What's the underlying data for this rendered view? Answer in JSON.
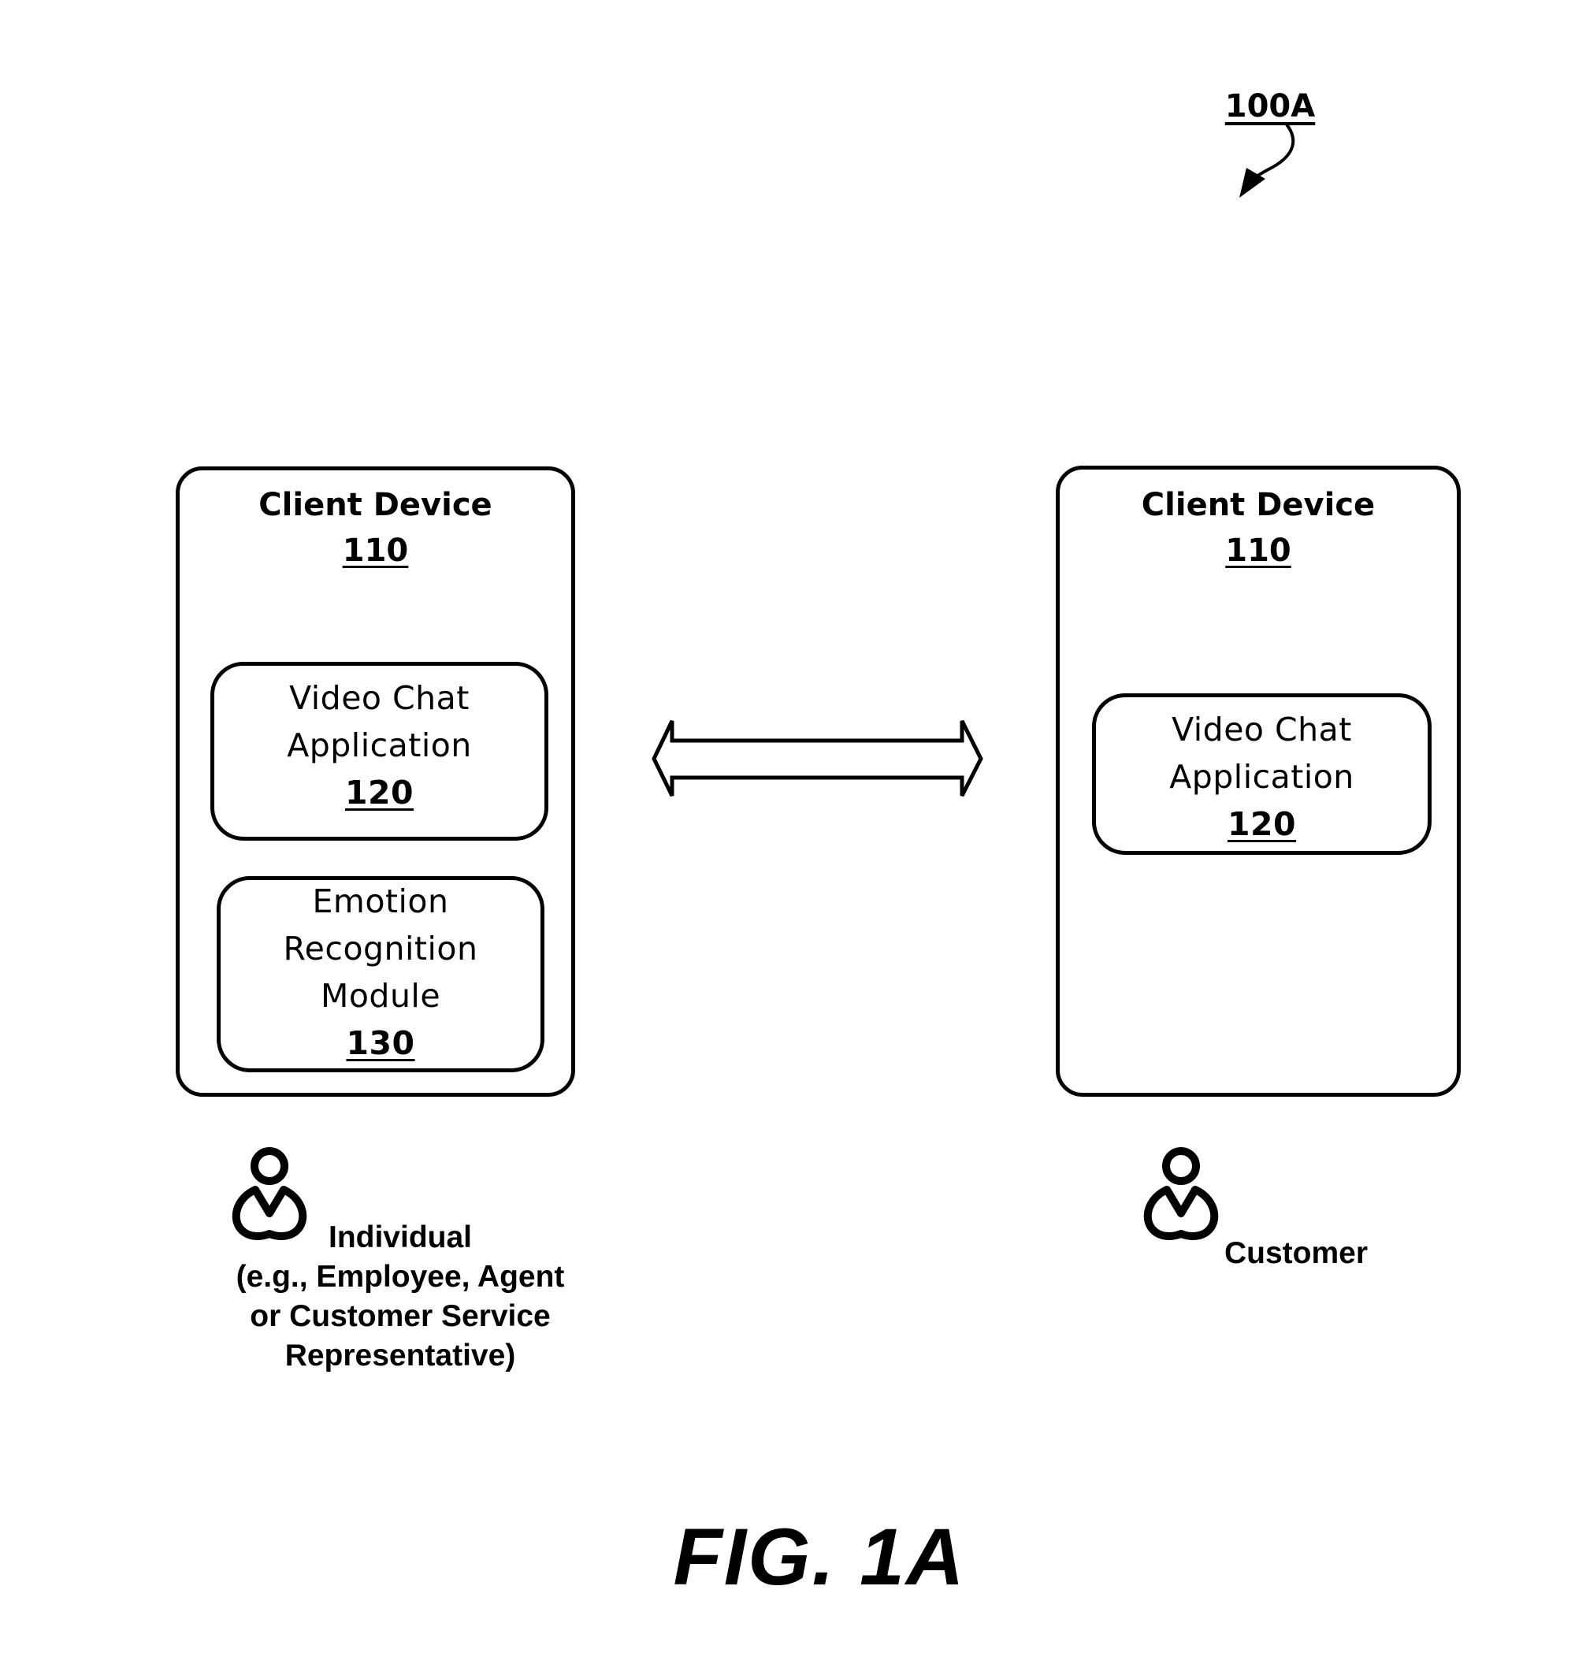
{
  "figure": {
    "ref_label": "100A",
    "caption": "FIG. 1A"
  },
  "left_device": {
    "title": "Client Device",
    "ref": "110",
    "components": [
      {
        "lines": [
          "Video Chat",
          "Application"
        ],
        "ref": "120"
      },
      {
        "lines": [
          "Emotion",
          "Recognition",
          "Module"
        ],
        "ref": "130"
      }
    ],
    "user": {
      "icon": "person-icon",
      "label_lines": [
        "Individual",
        "(e.g., Employee, Agent",
        "or Customer Service",
        "Representative)"
      ]
    }
  },
  "right_device": {
    "title": "Client Device",
    "ref": "110",
    "components": [
      {
        "lines": [
          "Video Chat",
          "Application"
        ],
        "ref": "120"
      }
    ],
    "user": {
      "icon": "person-icon",
      "label_lines": [
        "Customer"
      ]
    }
  },
  "connection": {
    "type": "bidirectional-arrow"
  }
}
